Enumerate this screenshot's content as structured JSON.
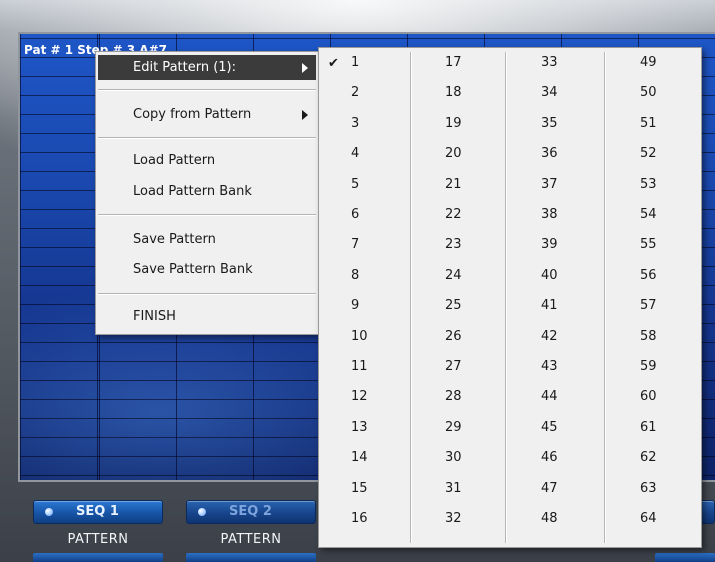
{
  "plugin": {
    "grid_header": "Pat # 1  Step # 3  A#7",
    "seq_buttons": [
      {
        "label": "SEQ 1",
        "caption": "PATTERN",
        "state": "active"
      },
      {
        "label": "SEQ 2",
        "caption": "PATTERN",
        "state": "inactive"
      }
    ],
    "colors": {
      "accent_blue": "#1a48ae",
      "button_blue": "#1754a6"
    }
  },
  "context_menu": {
    "items": [
      {
        "label": "Edit Pattern (1):",
        "submenu": true,
        "highlighted": true
      },
      {
        "label": "Copy from Pattern",
        "submenu": true
      },
      {
        "label": "Load Pattern"
      },
      {
        "label": "Load Pattern Bank"
      },
      {
        "label": "Save Pattern"
      },
      {
        "label": "Save Pattern Bank"
      },
      {
        "label": "FINISH"
      }
    ]
  },
  "pattern_submenu": {
    "checkmark": "✔",
    "checked": "1",
    "columns": [
      [
        "1",
        "2",
        "3",
        "4",
        "5",
        "6",
        "7",
        "8",
        "9",
        "10",
        "11",
        "12",
        "13",
        "14",
        "15",
        "16"
      ],
      [
        "17",
        "18",
        "19",
        "20",
        "21",
        "22",
        "23",
        "24",
        "25",
        "26",
        "27",
        "28",
        "29",
        "30",
        "31",
        "32"
      ],
      [
        "33",
        "34",
        "35",
        "36",
        "37",
        "38",
        "39",
        "40",
        "41",
        "42",
        "43",
        "44",
        "45",
        "46",
        "47",
        "48"
      ],
      [
        "49",
        "50",
        "51",
        "52",
        "53",
        "54",
        "55",
        "56",
        "57",
        "58",
        "59",
        "60",
        "61",
        "62",
        "63",
        "64"
      ]
    ]
  }
}
